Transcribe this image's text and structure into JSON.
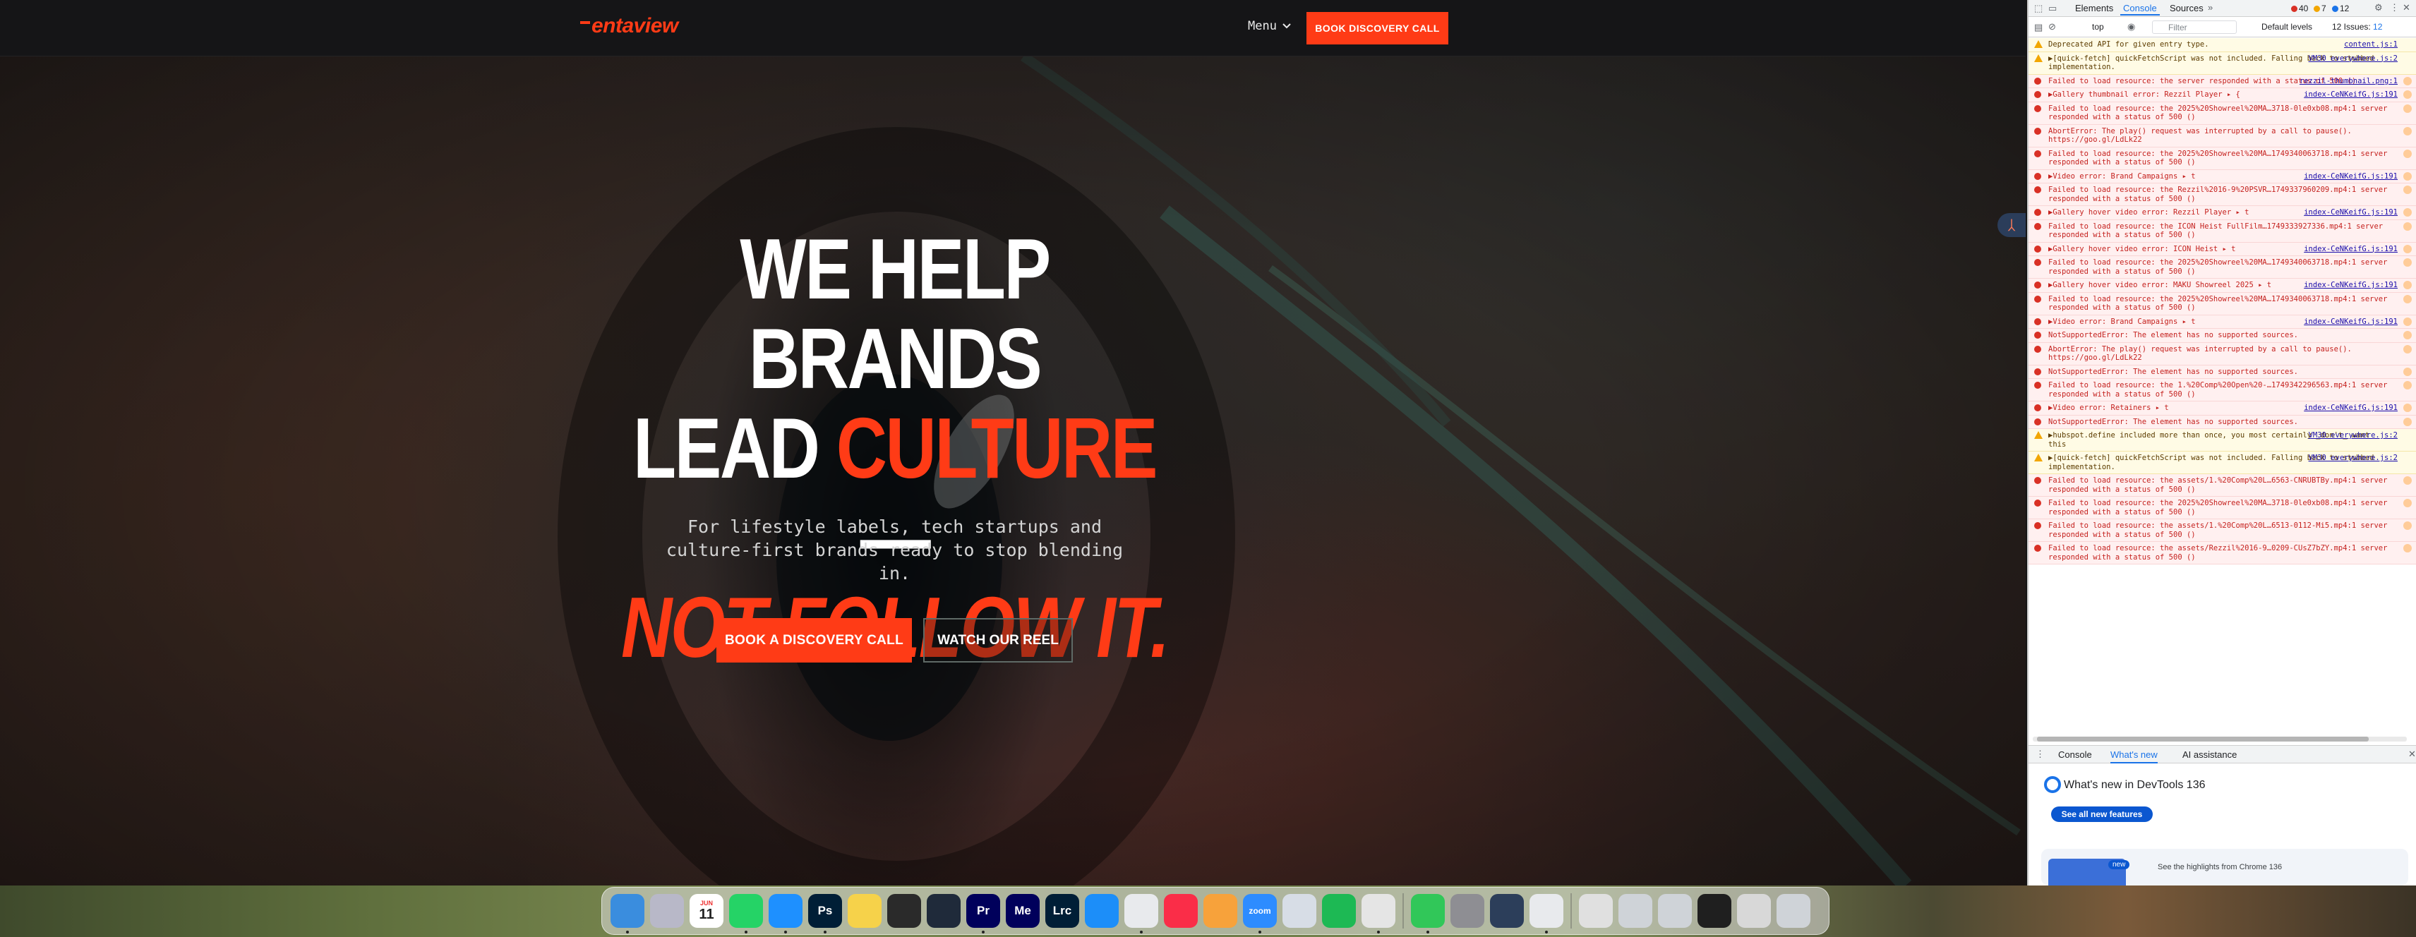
{
  "site": {
    "logo": "entaview",
    "menu_label": "Menu",
    "nav_cta": "BOOK DISCOVERY CALL",
    "hero": {
      "line1": "WE HELP BRANDS",
      "line2_a": "LEAD ",
      "line2_accent": "CULTURE",
      "line2_b": " —",
      "line3": "NOT FOLLOW IT.",
      "subtitle": "For lifestyle labels, tech startups and culture-first brands ready to stop blending in."
    },
    "cta_primary": "BOOK A DISCOVERY CALL",
    "cta_secondary": "WATCH OUR REEL",
    "accent_color": "#ff3b16"
  },
  "devtools": {
    "tabs": [
      "Elements",
      "Console",
      "Sources"
    ],
    "active_tab": "Console",
    "more_tabs": "»",
    "counts": {
      "errors": "40",
      "warnings": "7",
      "issues": "12"
    },
    "toolbar": {
      "context": "top",
      "filter_placeholder": "Filter",
      "levels": "Default levels",
      "issues": "12 Issues:",
      "issues_count": "12"
    },
    "logs": [
      {
        "level": "warn",
        "text": "Deprecated API for given entry type.",
        "src": "content.js:1"
      },
      {
        "level": "warn",
        "text": "▶[quick-fetch] quickFetchScript was not included. Falling back to stubbed implementation.",
        "src": "VM30 everywhere.js:2"
      },
      {
        "level": "err",
        "text": "Failed to load resource: the server responded with a status of 500 ()",
        "src": "rezzil-thumbnail.png:1"
      },
      {
        "level": "err",
        "text": "▶Gallery thumbnail error: Rezzil Player ▸ {",
        "src": "index-CeNKeifG.js:191"
      },
      {
        "level": "err",
        "text": "Failed to load resource: the 2025%20Showreel%20MA…3718-0le0xb08.mp4:1 server responded with a status of 500 ()",
        "src": ""
      },
      {
        "level": "err",
        "text": "AbortError: The play() request was interrupted by a call to pause(). https://goo.gl/LdLk22",
        "src": ""
      },
      {
        "level": "err",
        "text": "Failed to load resource: the 2025%20Showreel%20MA…1749340063718.mp4:1 server responded with a status of 500 ()",
        "src": ""
      },
      {
        "level": "err",
        "text": "▶Video error: Brand Campaigns ▸ t",
        "src": "index-CeNKeifG.js:191"
      },
      {
        "level": "err",
        "text": "Failed to load resource: the Rezzil%2016-9%20PSVR…1749337960209.mp4:1 server responded with a status of 500 ()",
        "src": ""
      },
      {
        "level": "err",
        "text": "▶Gallery hover video error: Rezzil Player ▸ t",
        "src": "index-CeNKeifG.js:191"
      },
      {
        "level": "err",
        "text": "Failed to load resource: the ICON Heist FullFilm…1749333927336.mp4:1 server responded with a status of 500 ()",
        "src": ""
      },
      {
        "level": "err",
        "text": "▶Gallery hover video error: ICON Heist ▸ t",
        "src": "index-CeNKeifG.js:191"
      },
      {
        "level": "err",
        "text": "Failed to load resource: the 2025%20Showreel%20MA…1749340063718.mp4:1 server responded with a status of 500 ()",
        "src": ""
      },
      {
        "level": "err",
        "text": "▶Gallery hover video error: MAKU Showreel 2025 ▸ t",
        "src": "index-CeNKeifG.js:191"
      },
      {
        "level": "err",
        "text": "Failed to load resource: the 2025%20Showreel%20MA…1749340063718.mp4:1 server responded with a status of 500 ()",
        "src": ""
      },
      {
        "level": "err",
        "text": "▶Video error: Brand Campaigns ▸ t",
        "src": "index-CeNKeifG.js:191"
      },
      {
        "level": "err",
        "text": "NotSupportedError: The element has no supported sources.",
        "src": ""
      },
      {
        "level": "err",
        "text": "AbortError: The play() request was interrupted by a call to pause(). https://goo.gl/LdLk22",
        "src": ""
      },
      {
        "level": "err",
        "text": "NotSupportedError: The element has no supported sources.",
        "src": ""
      },
      {
        "level": "err",
        "text": "Failed to load resource: the 1.%20Comp%20Open%20-…1749342296563.mp4:1 server responded with a status of 500 ()",
        "src": ""
      },
      {
        "level": "err",
        "text": "▶Video error: Retainers ▸ t",
        "src": "index-CeNKeifG.js:191"
      },
      {
        "level": "err",
        "text": "NotSupportedError: The element has no supported sources.",
        "src": ""
      },
      {
        "level": "warn",
        "text": "▶hubspot.define included more than once, you most certainly _don't_ want this",
        "src": "VM30 everywhere.js:2"
      },
      {
        "level": "warn",
        "text": "▶[quick-fetch] quickFetchScript was not included. Falling back to stubbed implementation.",
        "src": "VM30 everywhere.js:2"
      },
      {
        "level": "err",
        "text": "Failed to load resource: the assets/1.%20Comp%20L…6563-CNRUBTBy.mp4:1 server responded with a status of 500 ()",
        "src": ""
      },
      {
        "level": "err",
        "text": "Failed to load resource: the 2025%20Showreel%20MA…3718-0le0xb08.mp4:1 server responded with a status of 500 ()",
        "src": ""
      },
      {
        "level": "err",
        "text": "Failed to load resource: the assets/1.%20Comp%20L…6513-0112-Mi5.mp4:1 server responded with a status of 500 ()",
        "src": ""
      },
      {
        "level": "err",
        "text": "Failed to load resource: the assets/Rezzil%2016-9…0209-CUsZ7bZY.mp4:1 server responded with a status of 500 ()",
        "src": ""
      }
    ],
    "drawer_tabs": [
      "Console",
      "What's new",
      "AI assistance"
    ],
    "drawer_active": "What's new",
    "whats_new": {
      "title": "What's new in DevTools 136",
      "button": "See all new features",
      "new_badge": "new",
      "highlight": "See the highlights from Chrome 136"
    }
  },
  "dock": {
    "calendar_month": "JUN",
    "calendar_day": "11",
    "apps": [
      {
        "name": "finder",
        "label": "",
        "color": "#3a8dde"
      },
      {
        "name": "launchpad",
        "label": "",
        "color": "#b8b8c8"
      },
      {
        "name": "calendar",
        "label": "11",
        "color": "#ffffff"
      },
      {
        "name": "whatsapp",
        "label": "",
        "color": "#25d366"
      },
      {
        "name": "safari",
        "label": "",
        "color": "#1e90ff"
      },
      {
        "name": "photoshop",
        "label": "Ps",
        "color": "#001e36"
      },
      {
        "name": "notes",
        "label": "",
        "color": "#f6d24a"
      },
      {
        "name": "final-cut",
        "label": "",
        "color": "#2a2a2a"
      },
      {
        "name": "davinci",
        "label": "",
        "color": "#1f2a3a"
      },
      {
        "name": "premiere",
        "label": "Pr",
        "color": "#00005b"
      },
      {
        "name": "media-encoder",
        "label": "Me",
        "color": "#00005b"
      },
      {
        "name": "lightroom-classic",
        "label": "Lrc",
        "color": "#001e36"
      },
      {
        "name": "app-store",
        "label": "",
        "color": "#1c8ef9"
      },
      {
        "name": "chrome",
        "label": "",
        "color": "#e8eaed"
      },
      {
        "name": "music",
        "label": "",
        "color": "#fa2d48"
      },
      {
        "name": "pages",
        "label": "",
        "color": "#f7a23b"
      },
      {
        "name": "zoom",
        "label": "zoom",
        "color": "#2d8cff"
      },
      {
        "name": "preview",
        "label": "",
        "color": "#d7dde6"
      },
      {
        "name": "spotify",
        "label": "",
        "color": "#1db954"
      },
      {
        "name": "reminders",
        "label": "",
        "color": "#e5e5e5"
      },
      {
        "name": "facetime",
        "label": "",
        "color": "#31c759"
      },
      {
        "name": "system-settings",
        "label": "",
        "color": "#8e8e93"
      },
      {
        "name": "quicktime",
        "label": "",
        "color": "#2c3e5a"
      },
      {
        "name": "chrome-2",
        "label": "",
        "color": "#e8eaed"
      },
      {
        "name": "music-doc",
        "label": "",
        "color": "#e0e0e0"
      },
      {
        "name": "window-1",
        "label": "",
        "color": "#cfd3d8"
      },
      {
        "name": "window-2",
        "label": "",
        "color": "#cfd3d8"
      },
      {
        "name": "window-3",
        "label": "",
        "color": "#1f1f1f"
      },
      {
        "name": "window-4",
        "label": "",
        "color": "#d8d8d8"
      },
      {
        "name": "trash",
        "label": "",
        "color": "#cfd3d8"
      }
    ]
  }
}
